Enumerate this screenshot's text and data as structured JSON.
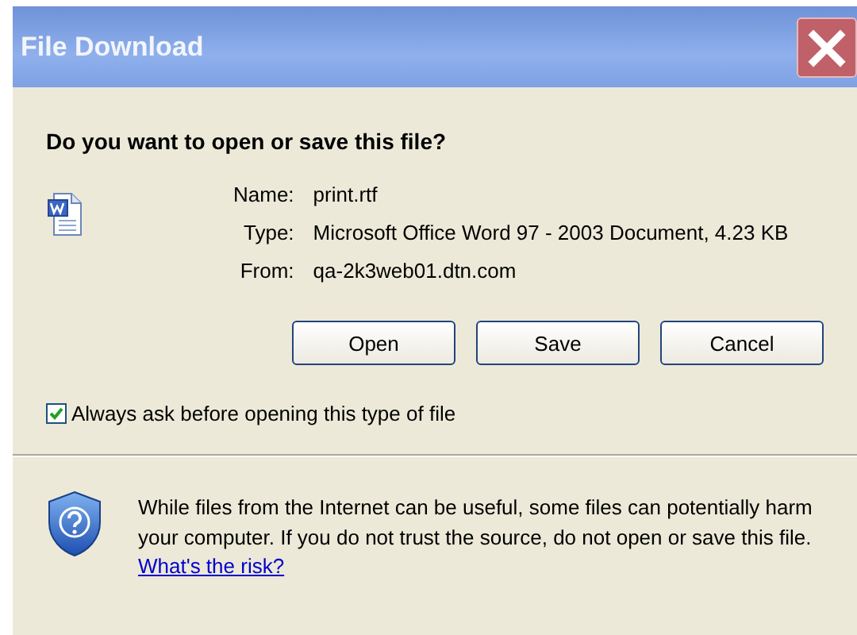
{
  "window": {
    "title": "File Download",
    "close": "×"
  },
  "question": "Do you want to open or save this file?",
  "details": [
    {
      "label": "Name:",
      "value": "print.rtf"
    },
    {
      "label": "Type:",
      "value": "Microsoft Office Word 97 - 2003 Document, 4.23 KB"
    },
    {
      "label": "From:",
      "value": "qa-2k3web01.dtn.com"
    }
  ],
  "buttons": [
    "Open",
    "Save",
    "Cancel"
  ],
  "always_ask": {
    "label": "Always ask before opening this type of file",
    "checked": true
  },
  "warning": {
    "text": "While files from the Internet can be useful, some files can potentially harm your computer. If you do not trust the source, do not open or save this file.",
    "link": "What's the risk?"
  }
}
